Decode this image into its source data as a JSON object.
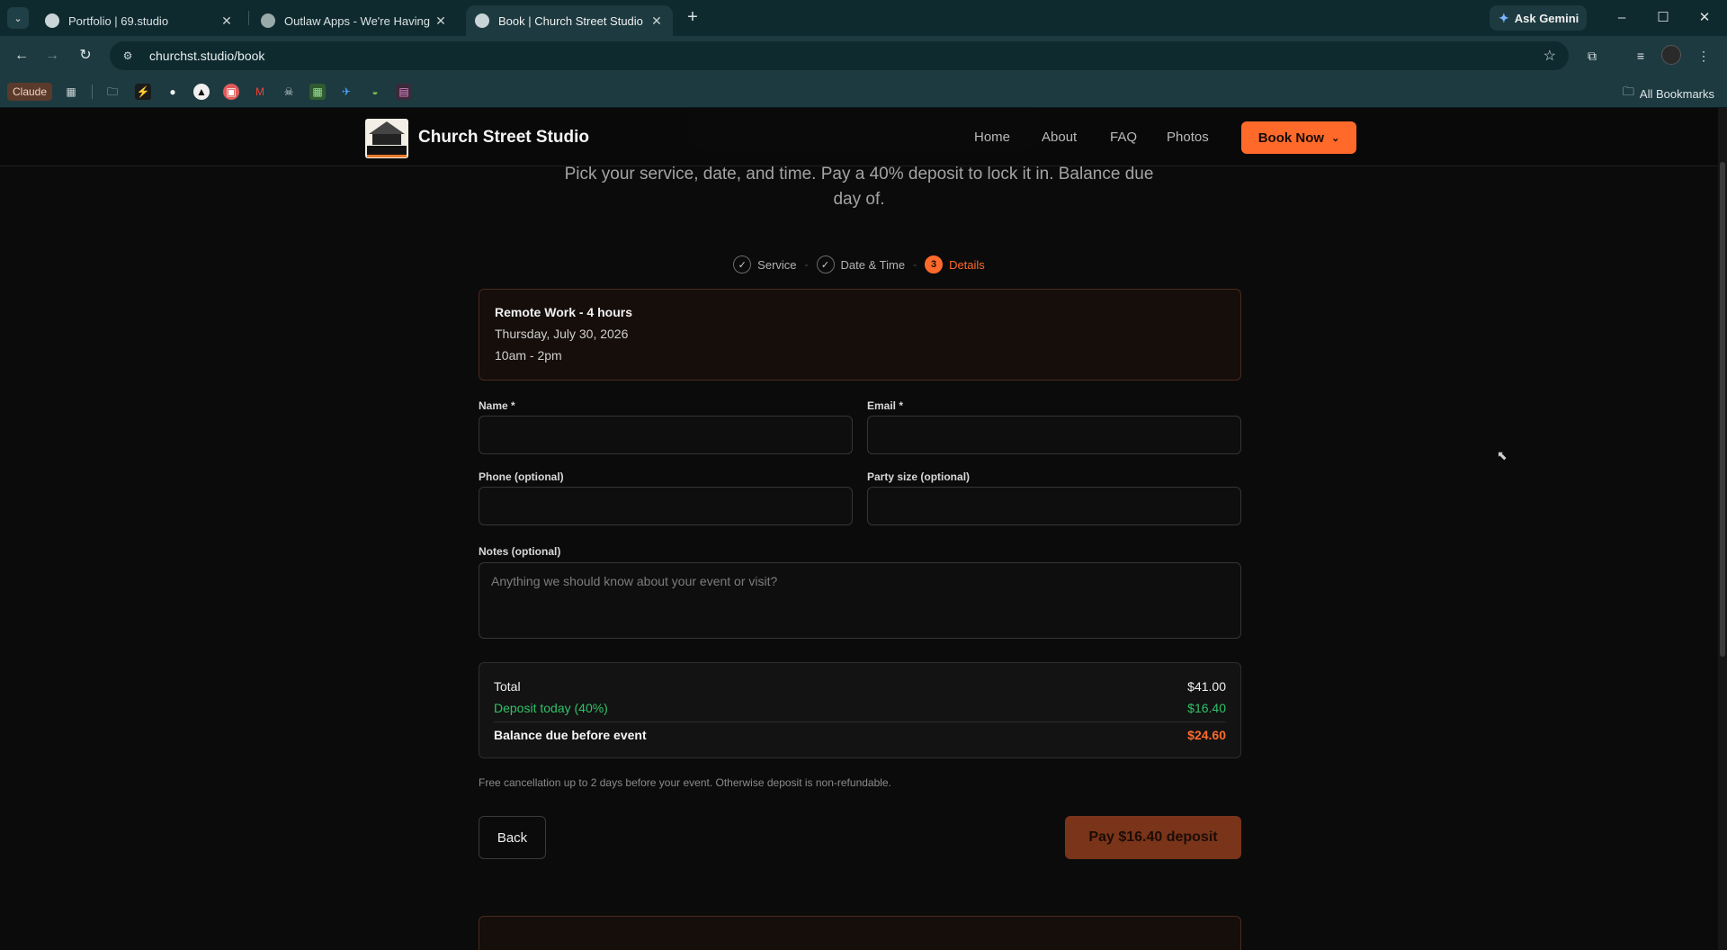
{
  "browser": {
    "tabs": [
      {
        "title": "Portfolio | 69.studio",
        "active": false
      },
      {
        "title": "Outlaw Apps - We're Having Fu",
        "active": false
      },
      {
        "title": "Book | Church Street Studio",
        "active": true
      }
    ],
    "ask_gemini": "Ask Gemini",
    "url": "churchst.studio/book",
    "bookmarks": {
      "claude_label": "Claude",
      "all_bookmarks": "All Bookmarks"
    }
  },
  "site": {
    "brand": "Church Street Studio",
    "nav": [
      "Home",
      "About",
      "FAQ",
      "Photos"
    ],
    "book_now": "Book Now"
  },
  "booking": {
    "subtitle": "Pick your service, date, and time. Pay a 40% deposit to lock it in. Balance due day of.",
    "steps": [
      {
        "label": "Service",
        "state": "done",
        "marker": "✓"
      },
      {
        "label": "Date & Time",
        "state": "done",
        "marker": "✓"
      },
      {
        "label": "Details",
        "state": "active",
        "marker": "3"
      }
    ],
    "summary": {
      "service": "Remote Work - 4 hours",
      "date": "Thursday, July 30, 2026",
      "time": "10am - 2pm"
    },
    "form": {
      "name_label": "Name *",
      "email_label": "Email *",
      "phone_label": "Phone (optional)",
      "party_label": "Party size (optional)",
      "notes_label": "Notes (optional)",
      "notes_placeholder": "Anything we should know about your event or visit?"
    },
    "totals": {
      "total_label": "Total",
      "total_value": "$41.00",
      "deposit_label": "Deposit today (40%)",
      "deposit_value": "$16.40",
      "balance_label": "Balance due before event",
      "balance_value": "$24.60"
    },
    "policy": "Free cancellation up to 2 days before your event. Otherwise deposit is non-refundable.",
    "back_label": "Back",
    "pay_label": "Pay $16.40 deposit"
  },
  "colors": {
    "accent": "#ff6a2b",
    "deposit_green": "#2fc26a",
    "chrome": "#1d3a40"
  }
}
